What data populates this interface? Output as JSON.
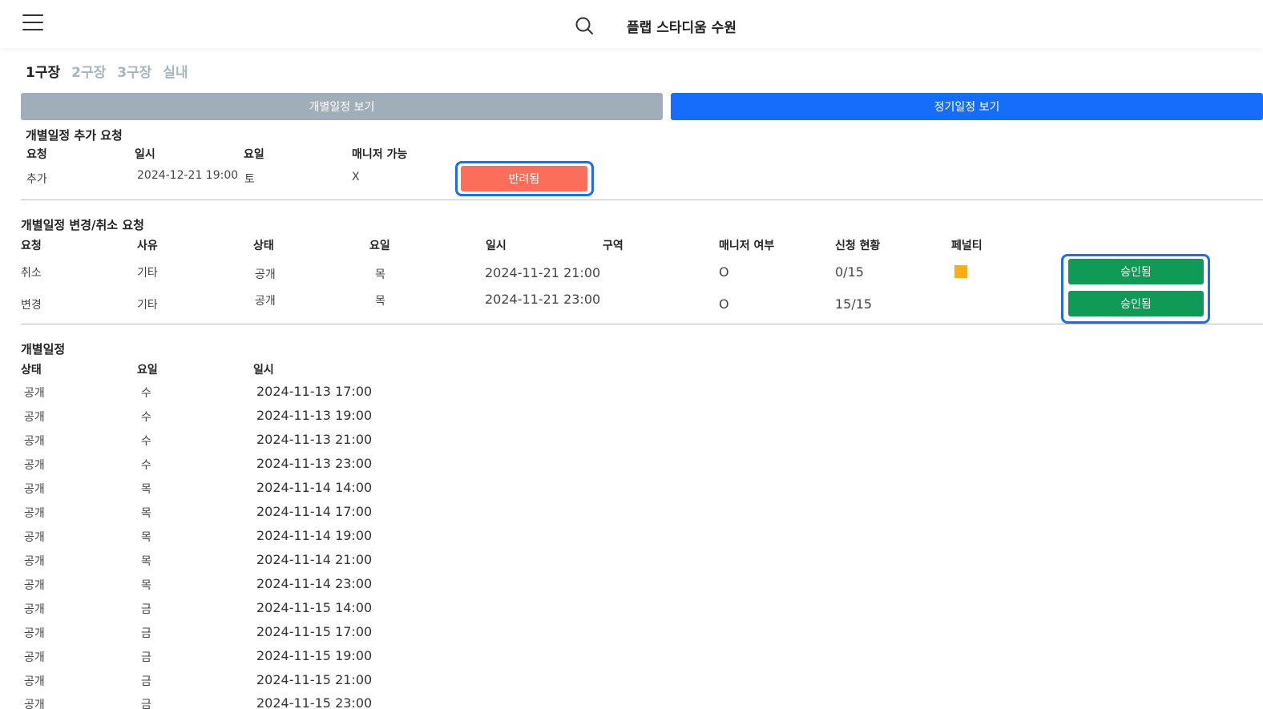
{
  "header": {
    "brand": "플랩 스타디움 수원",
    "menu_icon": "hamburger-menu-icon",
    "search_icon": "search-icon"
  },
  "tabs": [
    {
      "label": "1구장",
      "active": true
    },
    {
      "label": "2구장",
      "active": false
    },
    {
      "label": "3구장",
      "active": false
    },
    {
      "label": "실내",
      "active": false
    }
  ],
  "view_buttons": {
    "individual": "개별일정 보기",
    "regular": "정기일정 보기"
  },
  "colors": {
    "individual_btn": "#a0aeb9",
    "regular_btn": "#176dfb",
    "rejected": "#fa6e5a",
    "approved": "#0f9b55",
    "penalty": "#ffad14",
    "focus": "#1b6de8"
  },
  "add_request": {
    "title": "개별일정 추가 요청",
    "headers": [
      "요청",
      "일시",
      "요일",
      "매니저 가능"
    ],
    "row": {
      "request": "추가",
      "datetime": "2024-12-21 19:00",
      "weekday": "토",
      "manager": "X",
      "status": "반려됨"
    }
  },
  "change_request": {
    "title": "개별일정 변경/취소 요청",
    "headers": [
      "요청",
      "사유",
      "상태",
      "요일",
      "일시",
      "구역",
      "매니저 여부",
      "신청 현황",
      "페널티"
    ],
    "rows": [
      {
        "request": "취소",
        "reason": "기타",
        "state": "공개",
        "weekday": "목",
        "datetime": "2024-11-21 21:00",
        "zone": "",
        "manager": "O",
        "applied": "0/15",
        "penalty": true,
        "status": "승인됨"
      },
      {
        "request": "변경",
        "reason": "기타",
        "state": "공개",
        "weekday": "목",
        "datetime": "2024-11-21 23:00",
        "zone": "",
        "manager": "O",
        "applied": "15/15",
        "penalty": false,
        "status": "승인됨"
      }
    ]
  },
  "schedule": {
    "title": "개별일정",
    "headers": [
      "상태",
      "요일",
      "일시"
    ],
    "rows": [
      {
        "state": "공개",
        "weekday": "수",
        "datetime": "2024-11-13 17:00"
      },
      {
        "state": "공개",
        "weekday": "수",
        "datetime": "2024-11-13 19:00"
      },
      {
        "state": "공개",
        "weekday": "수",
        "datetime": "2024-11-13 21:00"
      },
      {
        "state": "공개",
        "weekday": "수",
        "datetime": "2024-11-13 23:00"
      },
      {
        "state": "공개",
        "weekday": "목",
        "datetime": "2024-11-14 14:00"
      },
      {
        "state": "공개",
        "weekday": "목",
        "datetime": "2024-11-14 17:00"
      },
      {
        "state": "공개",
        "weekday": "목",
        "datetime": "2024-11-14 19:00"
      },
      {
        "state": "공개",
        "weekday": "목",
        "datetime": "2024-11-14 21:00"
      },
      {
        "state": "공개",
        "weekday": "목",
        "datetime": "2024-11-14 23:00"
      },
      {
        "state": "공개",
        "weekday": "금",
        "datetime": "2024-11-15 14:00"
      },
      {
        "state": "공개",
        "weekday": "금",
        "datetime": "2024-11-15 17:00"
      },
      {
        "state": "공개",
        "weekday": "금",
        "datetime": "2024-11-15 19:00"
      },
      {
        "state": "공개",
        "weekday": "금",
        "datetime": "2024-11-15 21:00"
      },
      {
        "state": "공개",
        "weekday": "금",
        "datetime": "2024-11-15 23:00"
      }
    ]
  }
}
